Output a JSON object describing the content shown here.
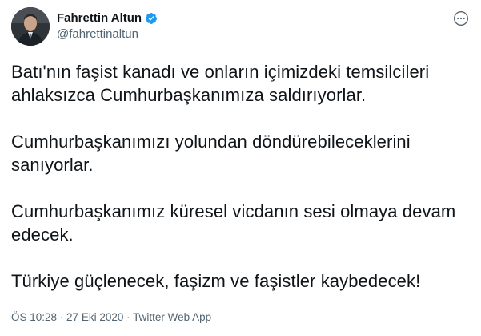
{
  "author": {
    "name": "Fahrettin Altun",
    "handle": "@fahrettinaltun"
  },
  "icons": {
    "verified": "verified-badge-icon",
    "more": "more-options-icon"
  },
  "colors": {
    "text": "#0f1419",
    "secondary": "#536471",
    "verified": "#1d9bf0"
  },
  "tweet": {
    "paragraphs": [
      "Batı'nın faşist kanadı ve onların içimizdeki temsilcileri ahlaksızca Cumhurbaşkanımıza saldırıyorlar.",
      "Cumhurbaşkanımızı yolundan döndürebileceklerini sanıyorlar.",
      "Cumhurbaşkanımız küresel vicdanın sesi olmaya devam edecek.",
      "Türkiye güçlenecek, faşizm ve faşistler kaybedecek!"
    ]
  },
  "meta": {
    "time": "ÖS 10:28",
    "separator1": " · ",
    "date": "27 Eki 2020",
    "separator2": " · ",
    "source": "Twitter Web App"
  }
}
